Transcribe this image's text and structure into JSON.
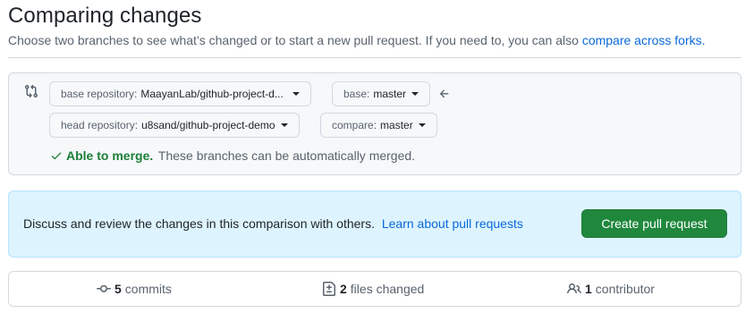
{
  "header": {
    "title": "Comparing changes",
    "subtitle_prefix": "Choose two branches to see what’s changed or to start a new pull request. If you need to, you can also",
    "compare_forks_link": "compare across forks."
  },
  "range": {
    "base_repository_label": "base repository:",
    "base_repository_value": "MaayanLab/github-project-d...",
    "base_label": "base:",
    "base_value": "master",
    "head_repository_label": "head repository:",
    "head_repository_value": "u8sand/github-project-demo",
    "compare_label": "compare:",
    "compare_value": "master",
    "merge_status": "Able to merge.",
    "merge_detail": "These branches can be automatically merged."
  },
  "discuss": {
    "text": "Discuss and review the changes in this comparison with others.",
    "learn_link": "Learn about pull requests",
    "create_button": "Create pull request"
  },
  "stats": {
    "commits_count": "5",
    "commits_label": "commits",
    "files_count": "2",
    "files_label": "files changed",
    "contributors_count": "1",
    "contributors_label": "contributor"
  },
  "colors": {
    "link": "#0969da",
    "success": "#1a7f37",
    "primary_button": "#1f883d",
    "info_bg": "#ddf4ff"
  },
  "icons": [
    "git-compare-icon",
    "arrow-left-icon",
    "check-icon",
    "git-commit-icon",
    "file-diff-icon",
    "people-icon",
    "caret-down-icon"
  ]
}
